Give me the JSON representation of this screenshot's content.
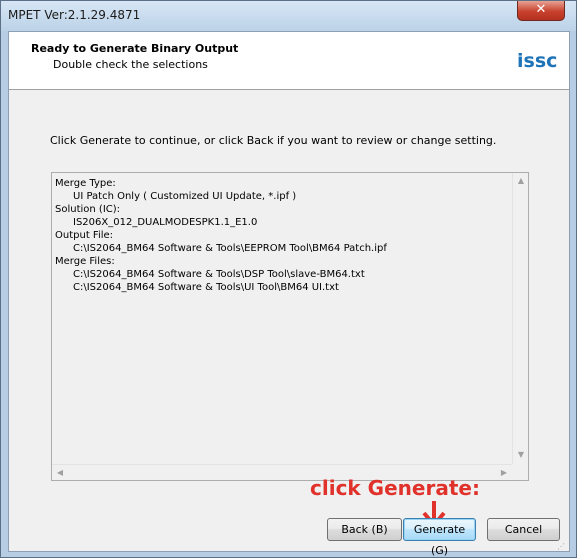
{
  "window": {
    "title": "MPET Ver:2.1.29.4871",
    "close_glyph": "✕"
  },
  "header": {
    "title": "Ready to Generate Binary Output",
    "subtitle": "Double check the selections",
    "logo_text": "ISSC"
  },
  "instruction": "Click Generate to continue, or click Back if you want to review or change setting.",
  "summary": {
    "lines": [
      {
        "text": "Merge Type:",
        "indent": false
      },
      {
        "text": "UI Patch Only ( Customized UI Update, *.ipf )",
        "indent": true
      },
      {
        "text": "Solution (IC):",
        "indent": false
      },
      {
        "text": "IS206X_012_DUALMODESPK1.1_E1.0",
        "indent": true
      },
      {
        "text": "Output File:",
        "indent": false
      },
      {
        "text": "C:\\IS2064_BM64 Software & Tools\\EEPROM Tool\\BM64 Patch.ipf",
        "indent": true
      },
      {
        "text": "Merge Files:",
        "indent": false
      },
      {
        "text": "C:\\IS2064_BM64 Software & Tools\\DSP Tool\\slave-BM64.txt",
        "indent": true
      },
      {
        "text": "C:\\IS2064_BM64 Software & Tools\\UI Tool\\BM64 UI.txt",
        "indent": true
      }
    ]
  },
  "annotation": {
    "text": "click Generate:",
    "color": "#e0322b"
  },
  "buttons": {
    "back": "Back (B)",
    "generate": "Generate (G)",
    "cancel": "Cancel"
  },
  "colors": {
    "accent_logo": "#1f74b8",
    "close_button": "#c7412e"
  },
  "icons": {
    "scroll_up": "scroll-up-arrow-icon",
    "scroll_down": "scroll-down-arrow-icon",
    "scroll_left": "scroll-left-arrow-icon",
    "scroll_right": "scroll-right-arrow-icon",
    "size_grip": "size-grip-icon",
    "annotation_arrow": "down-arrow-icon"
  }
}
